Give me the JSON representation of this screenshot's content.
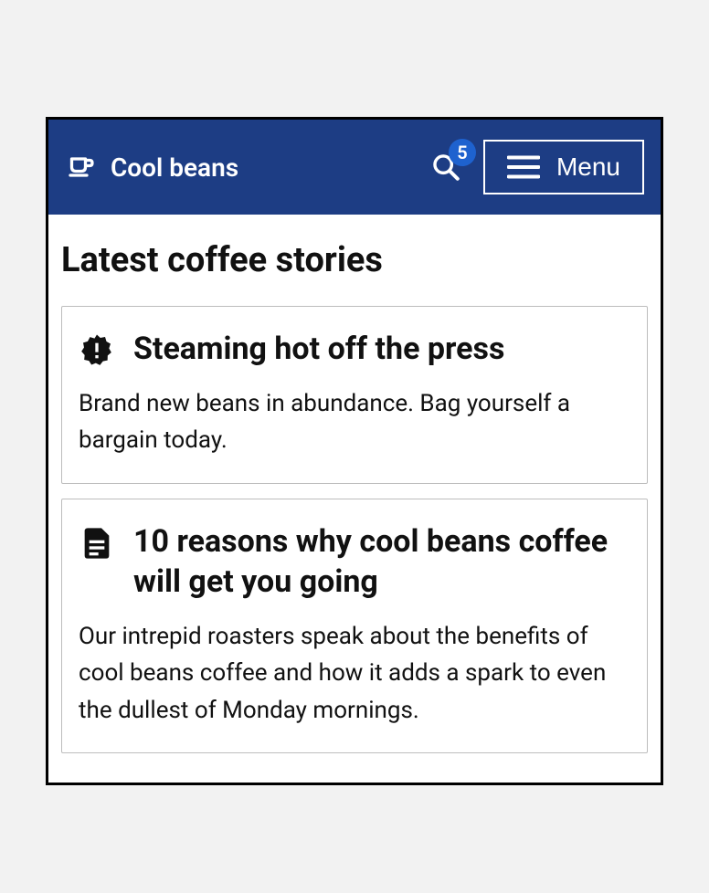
{
  "header": {
    "site_title": "Cool beans",
    "badge_count": "5",
    "menu_label": "Menu"
  },
  "main": {
    "page_title": "Latest coffee stories",
    "cards": [
      {
        "icon": "new-releases-icon",
        "title": "Steaming hot off the press",
        "body": "Brand new beans in abundance. Bag yourself a bargain today."
      },
      {
        "icon": "article-icon",
        "title": "10 reasons why cool beans coffee will get you going",
        "body": "Our intrepid roasters speak about the benefits of cool beans coffee and how it adds a spark to even the dullest of Monday mornings."
      }
    ]
  }
}
